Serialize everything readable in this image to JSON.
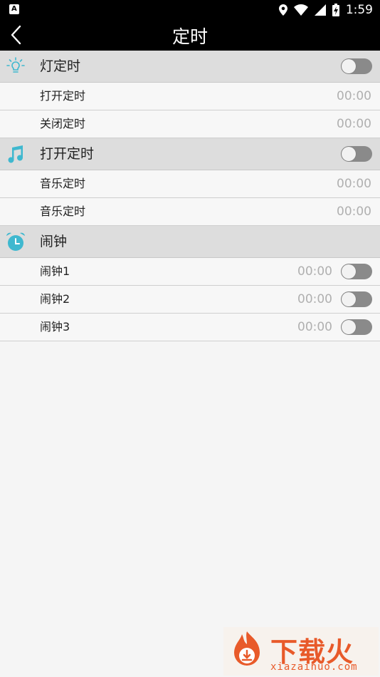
{
  "status_bar": {
    "time": "1:59",
    "icons": [
      "notification-a-icon",
      "location-icon",
      "wifi-icon",
      "signal-icon",
      "battery-charging-icon"
    ]
  },
  "app_bar": {
    "title": "定时",
    "back_icon": "chevron-left-icon"
  },
  "sections": [
    {
      "label": "灯定时",
      "icon": "light-bulb-icon",
      "toggle": false,
      "rows": [
        {
          "label": "打开定时",
          "value": "00:00"
        },
        {
          "label": "关闭定时",
          "value": "00:00"
        }
      ]
    },
    {
      "label": "打开定时",
      "icon": "music-note-icon",
      "toggle": false,
      "rows": [
        {
          "label": "音乐定时",
          "value": "00:00"
        },
        {
          "label": "音乐定时",
          "value": "00:00"
        }
      ]
    },
    {
      "label": "闹钟",
      "icon": "alarm-clock-icon",
      "rows": [
        {
          "label": "闹钟1",
          "value": "00:00",
          "toggle": false
        },
        {
          "label": "闹钟2",
          "value": "00:00",
          "toggle": false
        },
        {
          "label": "闹钟3",
          "value": "00:00",
          "toggle": false
        }
      ]
    }
  ],
  "watermark": {
    "text": "下载火",
    "url": "xiazaihuo.com"
  },
  "colors": {
    "header_bg": "#000000",
    "section_bg": "#dddddd",
    "row_bg": "#f7f7f7",
    "icon_accent": "#3fb8cf",
    "toggle_off": "#8a8a8a",
    "value_text": "#b0b0b0",
    "watermark_accent": "#e85a2a"
  }
}
